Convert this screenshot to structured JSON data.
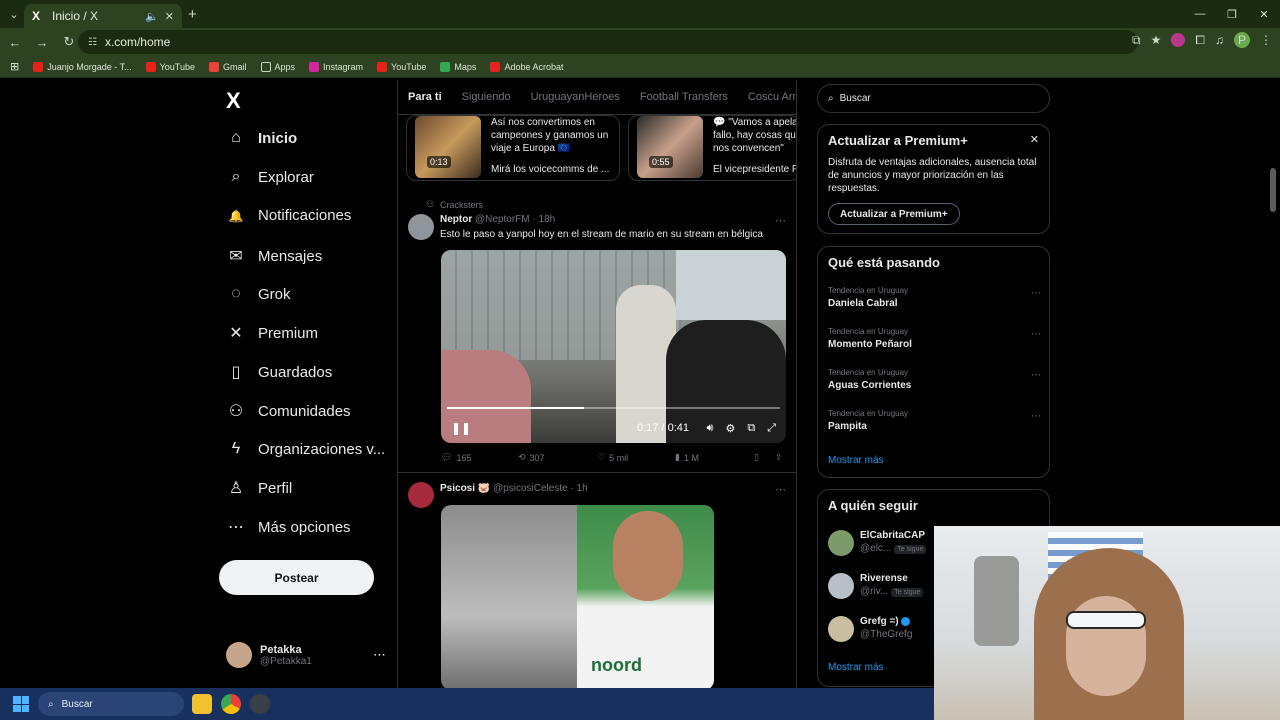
{
  "browser": {
    "tab_title": "Inicio / X",
    "tab_favicon": "X",
    "url": "x.com/home",
    "bookmarks": [
      {
        "label": "Juanjo Morgade - T...",
        "color": "#e62117"
      },
      {
        "label": "YouTube",
        "color": "#e62117"
      },
      {
        "label": "Gmail",
        "color": "#ea4335"
      },
      {
        "label": "Apps",
        "color": "#c9d1bf"
      },
      {
        "label": "Instagram",
        "color": "#d6249f"
      },
      {
        "label": "YouTube",
        "color": "#e62117"
      },
      {
        "label": "Maps",
        "color": "#34a853"
      },
      {
        "label": "Adobe Acrobat",
        "color": "#e02222"
      }
    ],
    "profile_initial": "P"
  },
  "sidebar": {
    "logo": "X",
    "items": [
      {
        "label": "Inicio",
        "icon": "home-icon",
        "glyph": "⌂"
      },
      {
        "label": "Explorar",
        "icon": "search-icon",
        "glyph": "⌕"
      },
      {
        "label": "Notificaciones",
        "icon": "bell-icon",
        "glyph": "🔔"
      },
      {
        "label": "Mensajes",
        "icon": "mail-icon",
        "glyph": "✉"
      },
      {
        "label": "Grok",
        "icon": "grok-icon",
        "glyph": "◌"
      },
      {
        "label": "Premium",
        "icon": "x-premium-icon",
        "glyph": "✕"
      },
      {
        "label": "Guardados",
        "icon": "bookmark-icon",
        "glyph": "▯"
      },
      {
        "label": "Comunidades",
        "icon": "people-icon",
        "glyph": "⚇"
      },
      {
        "label": "Organizaciones v...",
        "icon": "bolt-icon",
        "glyph": "ϟ"
      },
      {
        "label": "Perfil",
        "icon": "person-icon",
        "glyph": "♙"
      },
      {
        "label": "Más opciones",
        "icon": "more-circle-icon",
        "glyph": "⋯"
      }
    ],
    "post_button": "Postear",
    "user": {
      "name": "Petakka",
      "handle": "@Petakka1"
    }
  },
  "feed": {
    "tabs": [
      "Para ti",
      "Siguiendo",
      "UruguayanHeroes",
      "Football Transfers",
      "Coscu Army"
    ],
    "carousel": [
      {
        "text": "Así nos convertimos en campeones y ganamos un viaje a Europa 🇪🇺",
        "duration": "0:13",
        "foot": "Mirá los voicecomms de ..."
      },
      {
        "text": "💬 \"Vamos a apela fallo, hay cosas qu nos convencen\"",
        "duration": "0:55",
        "foot": "El vicepresidente F"
      }
    ],
    "post1": {
      "context": "Cracksters",
      "name": "Neptor",
      "handle": "@NeptorFM",
      "time": "· 18h",
      "text": "Esto le paso a yanpol hoy en el stream de mario en su stream en bélgica",
      "video_time": "0:17 / 0:41",
      "video_progress": 0.41,
      "replies": "165",
      "reposts": "307",
      "likes": "5 mil",
      "views": "1 M"
    },
    "post2": {
      "name": "Psicosi 🐷",
      "handle": "@psicosiCeleste",
      "time": "· 1h",
      "shirt_text": "noord"
    }
  },
  "right": {
    "search_placeholder": "Buscar",
    "premium": {
      "title": "Actualizar a Premium+",
      "desc": "Disfruta de ventajas adicionales, ausencia total de anuncios y mayor priorización en las respuestas.",
      "button": "Actualizar a Premium+"
    },
    "trends": {
      "title": "Qué está pasando",
      "items": [
        {
          "context": "Tendencia en Uruguay",
          "name": "Daniela Cabral"
        },
        {
          "context": "Tendencia en Uruguay",
          "name": "Momento Peñarol"
        },
        {
          "context": "Tendencia en Uruguay",
          "name": "Aguas Corrientes"
        },
        {
          "context": "Tendencia en Uruguay",
          "name": "Pampita"
        }
      ],
      "more": "Mostrar más"
    },
    "follow": {
      "title": "A quién seguir",
      "items": [
        {
          "name": "ElCabritaCAP",
          "handle": "@elc...",
          "badge": "Te sigue"
        },
        {
          "name": "Riverense",
          "handle": "@riv...",
          "badge": "Te sigue"
        },
        {
          "name": "Grefg =)",
          "handle": "@TheGrefg",
          "badge": ""
        }
      ],
      "more": "Mostrar más"
    }
  },
  "taskbar": {
    "search": "Buscar"
  }
}
